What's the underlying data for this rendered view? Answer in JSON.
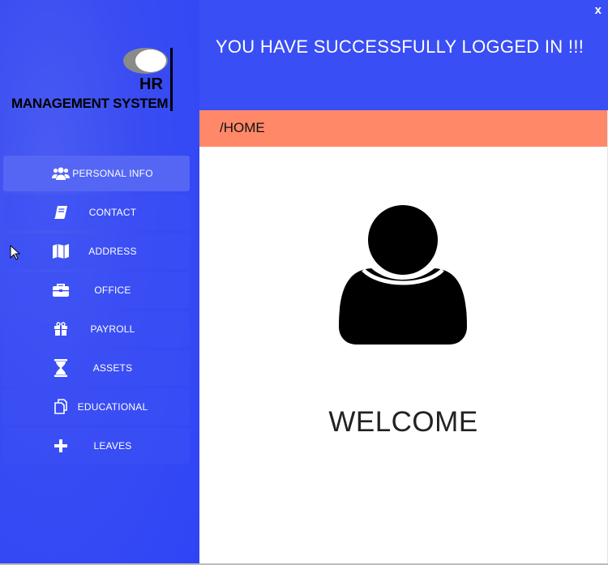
{
  "window": {
    "close_label": "x"
  },
  "header": {
    "title": "YOU HAVE SUCCESSFULLY LOGGED IN !!!"
  },
  "logo": {
    "hr": "HR",
    "system": "MANAGEMENT SYSTEM"
  },
  "breadcrumb": {
    "path": "/HOME"
  },
  "sidebar": {
    "items": [
      {
        "label": "PERSONAL INFO",
        "icon": "users-icon",
        "active": true
      },
      {
        "label": "CONTACT",
        "icon": "book-icon",
        "active": false
      },
      {
        "label": "ADDRESS",
        "icon": "map-icon",
        "active": false
      },
      {
        "label": "OFFICE",
        "icon": "briefcase-icon",
        "active": false
      },
      {
        "label": "PAYROLL",
        "icon": "gift-icon",
        "active": false
      },
      {
        "label": "ASSETS",
        "icon": "hourglass-icon",
        "active": false
      },
      {
        "label": "EDUCATIONAL",
        "icon": "documents-icon",
        "active": false
      },
      {
        "label": "LEAVES",
        "icon": "plus-icon",
        "active": false
      }
    ]
  },
  "main": {
    "welcome": "WELCOME",
    "avatar_icon": "user-icon"
  },
  "colors": {
    "sidebar": "#3a4df2",
    "header": "#3a4ef5",
    "breadcrumb": "#ff8868",
    "active_item": "#5466f3"
  }
}
